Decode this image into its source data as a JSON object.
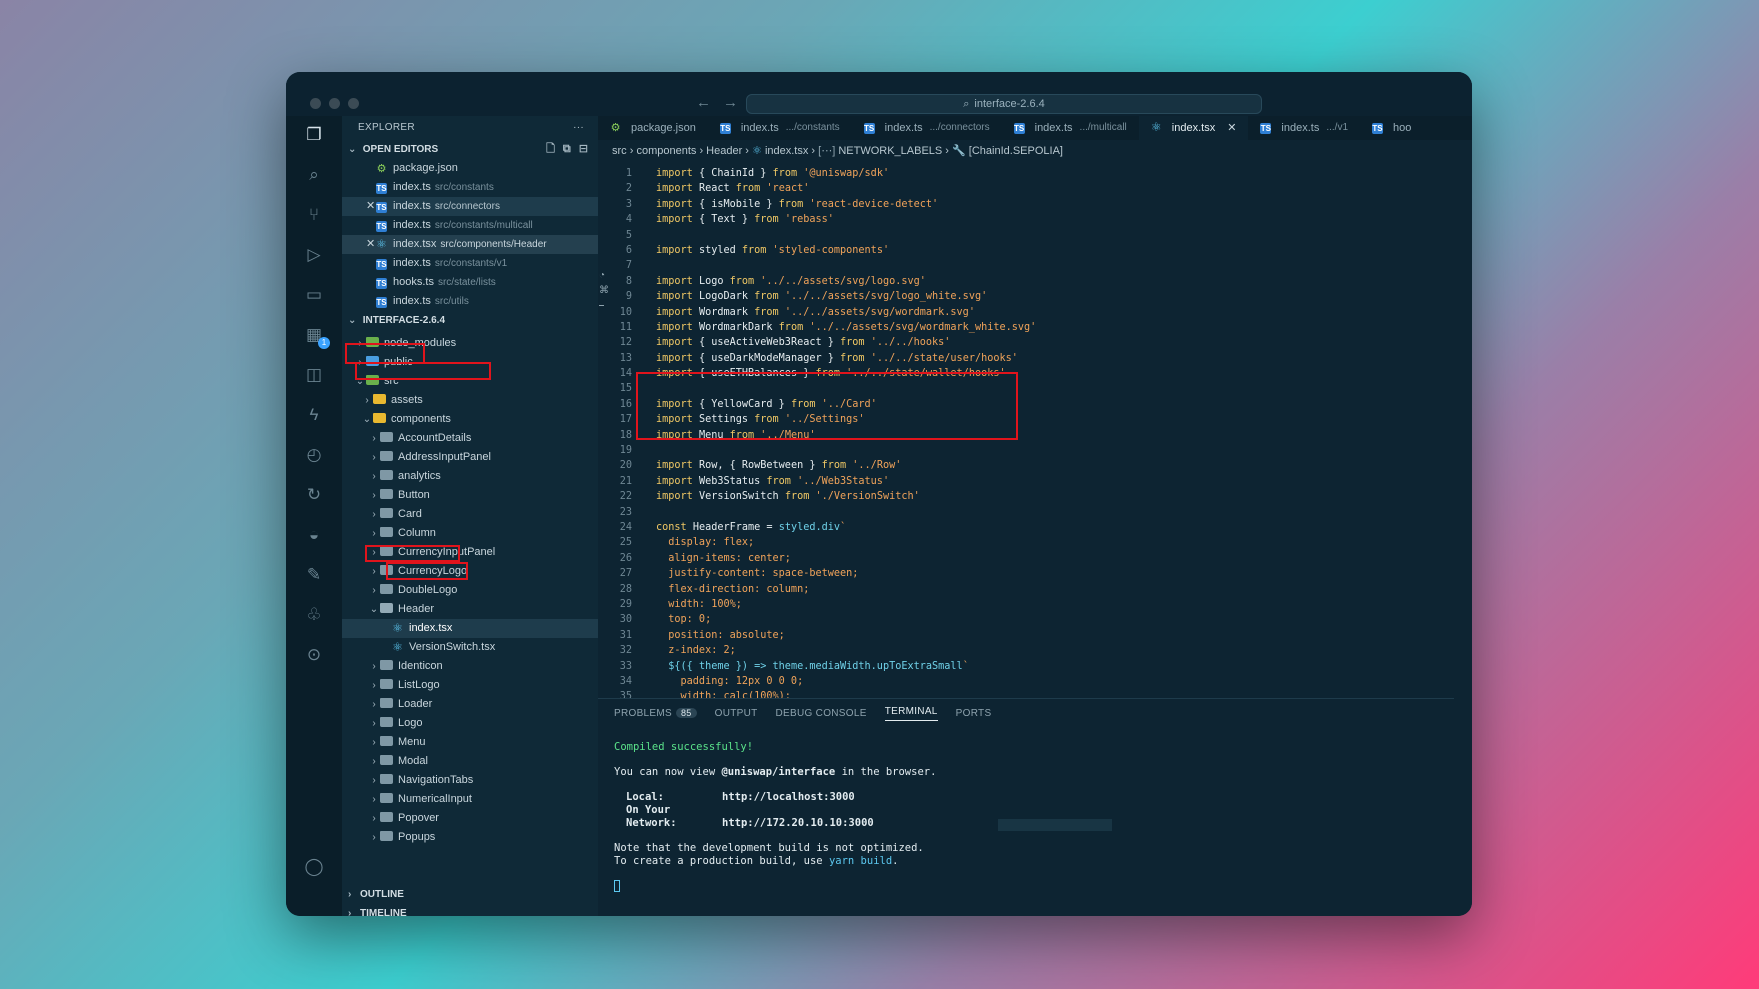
{
  "window": {
    "command_center": "interface-2.6.4"
  },
  "sidebar": {
    "header": "EXPLORER",
    "more": "···",
    "open_editors_title": "OPEN EDITORS",
    "open_editors": [
      {
        "name": "package.json",
        "path": "",
        "type": "json"
      },
      {
        "name": "index.ts",
        "path": "src/constants",
        "type": "ts"
      },
      {
        "name": "index.ts",
        "path": "src/connectors",
        "type": "ts",
        "close": "✕"
      },
      {
        "name": "index.ts",
        "path": "src/constants/multicall",
        "type": "ts"
      },
      {
        "name": "index.tsx",
        "path": "src/components/Header",
        "type": "tsx",
        "close": "✕"
      },
      {
        "name": "index.ts",
        "path": "src/constants/v1",
        "type": "ts"
      },
      {
        "name": "hooks.ts",
        "path": "src/state/lists",
        "type": "ts"
      },
      {
        "name": "index.ts",
        "path": "src/utils",
        "type": "ts"
      }
    ],
    "project_title": "INTERFACE-2.6.4",
    "tree": {
      "node_modules": "node_modules",
      "public": "public",
      "src": "src",
      "assets": "assets",
      "components": "components",
      "folders_a": [
        "AccountDetails",
        "AddressInputPanel",
        "analytics",
        "Button",
        "Card",
        "Column",
        "CurrencyInputPanel",
        "CurrencyLogo",
        "DoubleLogo"
      ],
      "header_folder": "Header",
      "header_files": [
        "index.tsx",
        "VersionSwitch.tsx"
      ],
      "folders_b": [
        "Identicon",
        "ListLogo",
        "Loader",
        "Logo",
        "Menu",
        "Modal",
        "NavigationTabs",
        "NumericalInput",
        "Popover",
        "Popups"
      ]
    },
    "outline": "OUTLINE",
    "timeline": "TIMELINE"
  },
  "tabs": [
    {
      "name": "package.json",
      "path": "",
      "type": "json"
    },
    {
      "name": "index.ts",
      "path": ".../constants",
      "type": "ts"
    },
    {
      "name": "index.ts",
      "path": ".../connectors",
      "type": "ts"
    },
    {
      "name": "index.ts",
      "path": ".../multicall",
      "type": "ts"
    },
    {
      "name": "index.tsx",
      "path": "",
      "type": "tsx",
      "active": true,
      "close": "✕"
    },
    {
      "name": "index.ts",
      "path": ".../v1",
      "type": "ts"
    },
    {
      "name": "hoo",
      "path": "",
      "type": "ts"
    }
  ],
  "breadcrumb": [
    "src",
    "components",
    "Header",
    "index.tsx",
    "NETWORK_LABELS",
    "[ChainId.SEPOLIA]"
  ],
  "code": [
    [
      [
        "kw",
        "import "
      ],
      [
        "id",
        "{ ChainId } "
      ],
      [
        "kw",
        "from "
      ],
      [
        "str",
        "'@uniswap/sdk'"
      ]
    ],
    [
      [
        "kw",
        "import "
      ],
      [
        "id",
        "React "
      ],
      [
        "kw",
        "from "
      ],
      [
        "str",
        "'react'"
      ]
    ],
    [
      [
        "kw",
        "import "
      ],
      [
        "id",
        "{ isMobile } "
      ],
      [
        "kw",
        "from "
      ],
      [
        "str",
        "'react-device-detect'"
      ]
    ],
    [
      [
        "kw",
        "import "
      ],
      [
        "id",
        "{ Text } "
      ],
      [
        "kw",
        "from "
      ],
      [
        "str",
        "'rebass'"
      ]
    ],
    [],
    [
      [
        "kw",
        "import "
      ],
      [
        "id",
        "styled "
      ],
      [
        "kw",
        "from "
      ],
      [
        "str",
        "'styled-components'"
      ]
    ],
    [],
    [
      [
        "kw",
        "import "
      ],
      [
        "id",
        "Logo "
      ],
      [
        "kw",
        "from "
      ],
      [
        "str",
        "'../../assets/svg/logo.svg'"
      ]
    ],
    [
      [
        "kw",
        "import "
      ],
      [
        "id",
        "LogoDark "
      ],
      [
        "kw",
        "from "
      ],
      [
        "str",
        "'../../assets/svg/logo_white.svg'"
      ]
    ],
    [
      [
        "kw",
        "import "
      ],
      [
        "id",
        "Wordmark "
      ],
      [
        "kw",
        "from "
      ],
      [
        "str",
        "'../../assets/svg/wordmark.svg'"
      ]
    ],
    [
      [
        "kw",
        "import "
      ],
      [
        "id",
        "WordmarkDark "
      ],
      [
        "kw",
        "from "
      ],
      [
        "str",
        "'../../assets/svg/wordmark_white.svg'"
      ]
    ],
    [
      [
        "kw",
        "import "
      ],
      [
        "id",
        "{ useActiveWeb3React } "
      ],
      [
        "kw",
        "from "
      ],
      [
        "str",
        "'../../hooks'"
      ]
    ],
    [
      [
        "kw",
        "import "
      ],
      [
        "id",
        "{ useDarkModeManager } "
      ],
      [
        "kw",
        "from "
      ],
      [
        "str",
        "'../../state/user/hooks'"
      ]
    ],
    [
      [
        "kw",
        "import "
      ],
      [
        "id",
        "{ useETHBalances } "
      ],
      [
        "kw",
        "from "
      ],
      [
        "str",
        "'../../state/wallet/hooks'"
      ]
    ],
    [],
    [
      [
        "kw",
        "import "
      ],
      [
        "id",
        "{ YellowCard } "
      ],
      [
        "kw",
        "from "
      ],
      [
        "str",
        "'../Card'"
      ]
    ],
    [
      [
        "kw",
        "import "
      ],
      [
        "id",
        "Settings "
      ],
      [
        "kw",
        "from "
      ],
      [
        "str",
        "'../Settings'"
      ]
    ],
    [
      [
        "kw",
        "import "
      ],
      [
        "id",
        "Menu "
      ],
      [
        "kw",
        "from "
      ],
      [
        "str",
        "'../Menu'"
      ]
    ],
    [],
    [
      [
        "kw",
        "import "
      ],
      [
        "id",
        "Row, { RowBetween } "
      ],
      [
        "kw",
        "from "
      ],
      [
        "str",
        "'../Row'"
      ]
    ],
    [
      [
        "kw",
        "import "
      ],
      [
        "id",
        "Web3Status "
      ],
      [
        "kw",
        "from "
      ],
      [
        "str",
        "'../Web3Status'"
      ]
    ],
    [
      [
        "kw",
        "import "
      ],
      [
        "id",
        "VersionSwitch "
      ],
      [
        "kw",
        "from "
      ],
      [
        "str",
        "'./VersionSwitch'"
      ]
    ],
    [],
    [
      [
        "kw",
        "const "
      ],
      [
        "id",
        "HeaderFrame = "
      ],
      [
        "fn",
        "styled.div"
      ],
      [
        "str",
        "`"
      ]
    ],
    [
      [
        "str",
        "  display: flex;"
      ]
    ],
    [
      [
        "str",
        "  align-items: center;"
      ]
    ],
    [
      [
        "str",
        "  justify-content: space-between;"
      ]
    ],
    [
      [
        "str",
        "  flex-direction: column;"
      ]
    ],
    [
      [
        "str",
        "  width: 100%;"
      ]
    ],
    [
      [
        "str",
        "  top: 0;"
      ]
    ],
    [
      [
        "str",
        "  position: absolute;"
      ]
    ],
    [
      [
        "str",
        "  z-index: 2;"
      ]
    ],
    [
      [
        "fn",
        "  ${({ "
      ],
      [
        "fn",
        "theme"
      ],
      [
        "fn",
        " }) => theme.mediaWidth.upToExtraSmall"
      ],
      [
        "str",
        "`"
      ]
    ],
    [
      [
        "str",
        "    padding: 12px 0 0 0;"
      ]
    ],
    [
      [
        "str",
        "    width: calc(100%);"
      ]
    ]
  ],
  "panel": {
    "tabs": [
      "PROBLEMS",
      "OUTPUT",
      "DEBUG CONSOLE",
      "TERMINAL",
      "PORTS"
    ],
    "problems_count": "85",
    "terminal": {
      "compiled": "Compiled successfully!",
      "view_prefix": "You can now view ",
      "app": "@uniswap/interface",
      "view_suffix": " in the browser.",
      "local_label": "Local:",
      "local_url": "http://localhost:3000",
      "network_label": "On Your Network:",
      "network_url": "http://172.20.10.10:3000",
      "note1": "Note that the development build is not optimized.",
      "note2_prefix": "To create a production build, use ",
      "note2_cmd": "yarn build",
      "note2_suffix": "."
    }
  }
}
